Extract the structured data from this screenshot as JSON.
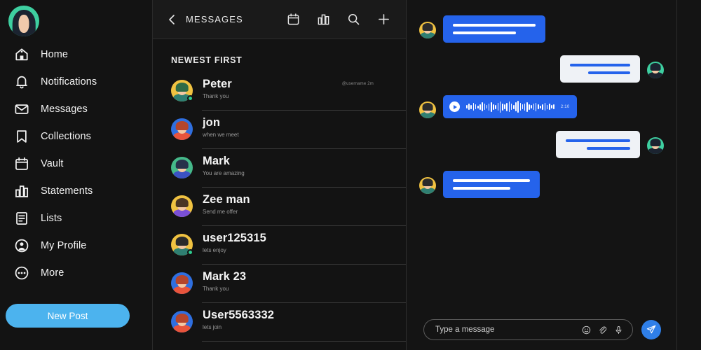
{
  "sidebar": {
    "avatar_name": "user-avatar",
    "items": [
      {
        "label": "Home",
        "icon": "home-icon"
      },
      {
        "label": "Notifications",
        "icon": "bell-icon"
      },
      {
        "label": "Messages",
        "icon": "envelope-icon"
      },
      {
        "label": "Collections",
        "icon": "bookmark-icon"
      },
      {
        "label": "Vault",
        "icon": "calendar-icon"
      },
      {
        "label": "Statements",
        "icon": "bar-chart-icon"
      },
      {
        "label": "Lists",
        "icon": "list-document-icon"
      },
      {
        "label": "My Profile",
        "icon": "person-circle-icon"
      },
      {
        "label": "More",
        "icon": "ellipsis-circle-icon"
      }
    ],
    "new_post_label": "New Post",
    "accent_color": "#4cb3ee"
  },
  "message_list": {
    "back_icon": "chevron-left-icon",
    "title": "MESSAGES",
    "actions": [
      {
        "icon": "calendar-icon",
        "name": "calendar-button"
      },
      {
        "icon": "bar-chart-icon",
        "name": "statistics-button"
      },
      {
        "icon": "search-icon",
        "name": "search-button"
      },
      {
        "icon": "plus-icon",
        "name": "new-message-button"
      }
    ],
    "sort_label": "NEWEST FIRST",
    "conversations": [
      {
        "name": "Peter",
        "preview": "Thank you",
        "meta": "@username 2m",
        "online": true,
        "avatar": {
          "bg": "#f0c241",
          "hair": "#2f6b46",
          "body": "#2f7f72"
        }
      },
      {
        "name": "jon",
        "preview": "when we meet",
        "meta": "",
        "online": false,
        "avatar": {
          "bg": "#2f6fe0",
          "hair": "#b5452c",
          "body": "#e8543c"
        }
      },
      {
        "name": "Mark",
        "preview": "You are amazing",
        "meta": "",
        "online": false,
        "avatar": {
          "bg": "#45b98a",
          "hair": "#27304a",
          "body": "#3b52c4"
        }
      },
      {
        "name": "Zee man",
        "preview": "Send me offer",
        "meta": "",
        "online": false,
        "avatar": {
          "bg": "#f0c241",
          "hair": "#4a3524",
          "body": "#7a4fd6"
        }
      },
      {
        "name": "user125315",
        "preview": "lets enjoy",
        "meta": "",
        "online": true,
        "avatar": {
          "bg": "#f0c241",
          "hair": "#2b2b2b",
          "body": "#2f7f72"
        }
      },
      {
        "name": "Mark 23",
        "preview": "Thank you",
        "meta": "",
        "online": false,
        "avatar": {
          "bg": "#2f6fe0",
          "hair": "#b5452c",
          "body": "#e8543c"
        }
      },
      {
        "name": "User5563332",
        "preview": "lets join",
        "meta": "",
        "online": false,
        "avatar": {
          "bg": "#2f6fe0",
          "hair": "#b5452c",
          "body": "#e8543c"
        }
      }
    ]
  },
  "chat": {
    "messages": [
      {
        "type": "text",
        "side": "left",
        "lines": [
          118,
          90
        ],
        "avatar": {
          "bg": "#f0c241",
          "hair": "#2b2b2b",
          "body": "#2f7f72"
        }
      },
      {
        "type": "text",
        "side": "right",
        "lines": [
          86,
          60
        ],
        "avatar": {
          "bg": "#3ecfa0",
          "hair": "#1b2330",
          "body": "#1b2330"
        }
      },
      {
        "type": "voice",
        "side": "left",
        "duration": "2:10",
        "avatar": {
          "bg": "#f0c241",
          "hair": "#2b2b2b",
          "body": "#2f7f72"
        }
      },
      {
        "type": "text",
        "side": "right",
        "lines": [
          92,
          62
        ],
        "avatar": {
          "bg": "#3ecfa0",
          "hair": "#1b2330",
          "body": "#1b2330"
        }
      },
      {
        "type": "text",
        "side": "left",
        "lines": [
          110,
          82
        ],
        "avatar": {
          "bg": "#f0c241",
          "hair": "#2b2b2b",
          "body": "#2f7f72"
        }
      }
    ],
    "bubble_blue": "#2563eb",
    "bubble_white": "#eff2f6",
    "composer": {
      "placeholder": "Type a message",
      "value": "",
      "icons": [
        {
          "icon": "emoji-icon",
          "name": "emoji-button"
        },
        {
          "icon": "paperclip-icon",
          "name": "attachment-button"
        },
        {
          "icon": "microphone-icon",
          "name": "voice-record-button"
        }
      ],
      "send_icon": "send-icon"
    }
  }
}
